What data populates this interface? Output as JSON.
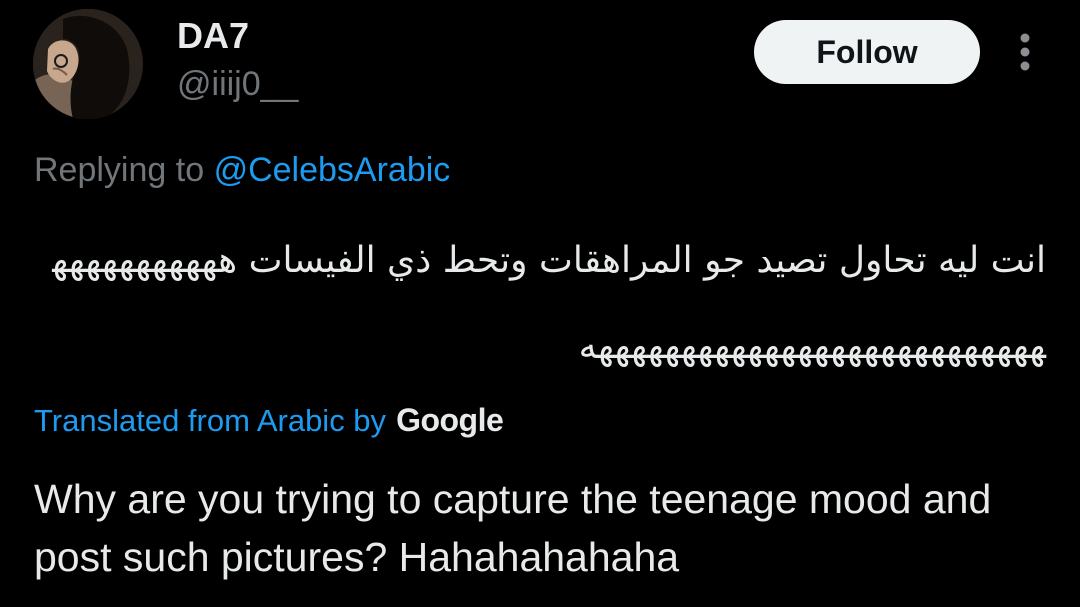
{
  "tweet": {
    "author": {
      "display_name": "DA7",
      "handle": "@iiij0__",
      "avatar_icon": "profile-photo"
    },
    "follow_label": "Follow",
    "more_icon": "more-vertical-icon",
    "replying_prefix": "Replying to",
    "replying_to": "@CelebsArabic",
    "original_text": "انت ليه تحاول تصيد جو المراهقات وتحط ذي الفيسات ههههههههههههههههههههههههههههههههههههههه",
    "translation": {
      "label": "Translated from Arabic by",
      "provider": "Google",
      "text": "Why are you trying to capture the teenage mood and post such pictures? Hahahahahaha"
    }
  },
  "colors": {
    "background": "#000000",
    "primary_text": "#e7e9ea",
    "secondary_text": "#71767b",
    "link": "#1d9bf0",
    "follow_bg": "#eff3f4",
    "follow_text": "#0f1419"
  }
}
